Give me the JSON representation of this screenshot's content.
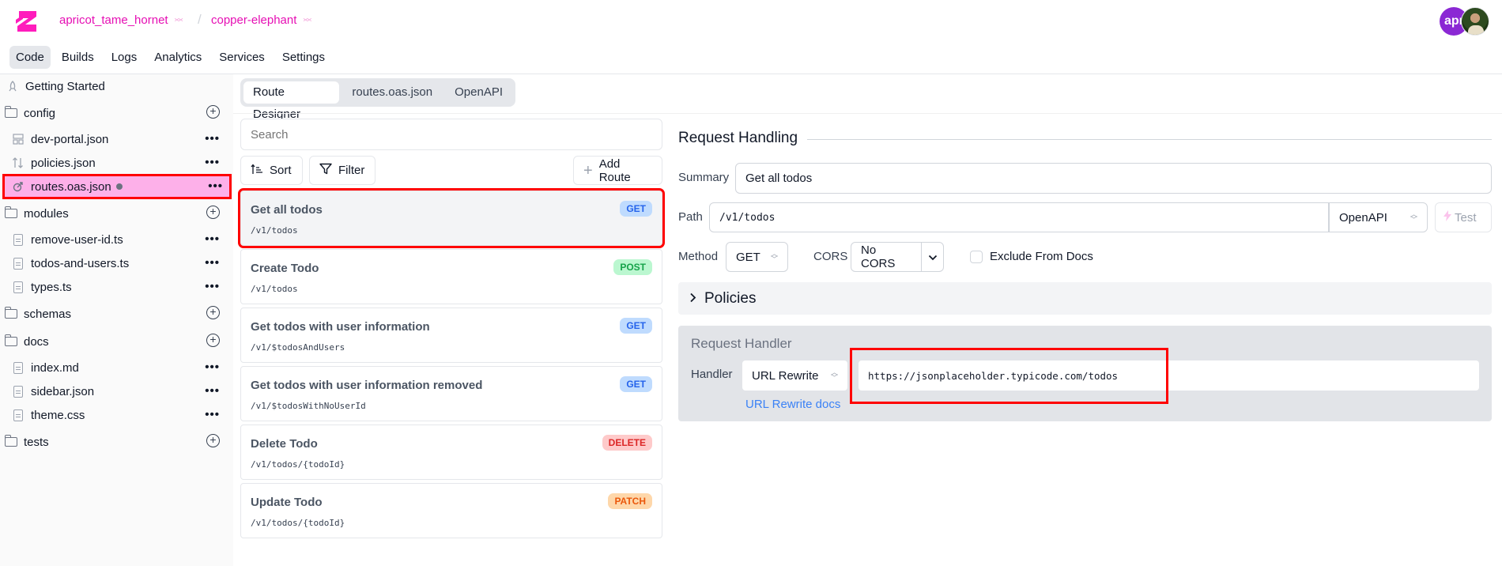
{
  "header": {
    "logo": "zuplo-logo-icon",
    "breadcrumb": {
      "account": "apricot_tame_hornet",
      "separator": "/",
      "project": "copper-elephant"
    },
    "nav_tabs": [
      {
        "label": "Code",
        "active": true
      },
      {
        "label": "Builds",
        "active": false
      },
      {
        "label": "Logs",
        "active": false
      },
      {
        "label": "Analytics",
        "active": false
      },
      {
        "label": "Services",
        "active": false
      },
      {
        "label": "Settings",
        "active": false
      }
    ],
    "avatars": [
      {
        "initials": "apr",
        "color": "#8b28d4"
      },
      {
        "type": "photo"
      }
    ]
  },
  "sidebar": {
    "getting_started": "Getting Started",
    "items": [
      {
        "type": "folder",
        "label": "config",
        "action": "add"
      },
      {
        "type": "file",
        "label": "dev-portal.json",
        "icon": "layout-icon",
        "action": "more"
      },
      {
        "type": "file",
        "label": "policies.json",
        "icon": "arrows-up-down-icon",
        "action": "more"
      },
      {
        "type": "file",
        "label": "routes.oas.json",
        "icon": "route-icon",
        "action": "more",
        "selected": true,
        "modified": true
      },
      {
        "type": "folder",
        "label": "modules",
        "action": "add"
      },
      {
        "type": "file",
        "label": "remove-user-id.ts",
        "icon": "file-icon",
        "action": "more"
      },
      {
        "type": "file",
        "label": "todos-and-users.ts",
        "icon": "file-icon",
        "action": "more"
      },
      {
        "type": "file",
        "label": "types.ts",
        "icon": "file-icon",
        "action": "more"
      },
      {
        "type": "folder",
        "label": "schemas",
        "action": "add"
      },
      {
        "type": "folder",
        "label": "docs",
        "action": "add"
      },
      {
        "type": "file",
        "label": "index.md",
        "icon": "file-icon",
        "action": "more"
      },
      {
        "type": "file",
        "label": "sidebar.json",
        "icon": "file-icon",
        "action": "more"
      },
      {
        "type": "file",
        "label": "theme.css",
        "icon": "file-icon",
        "action": "more"
      },
      {
        "type": "folder",
        "label": "tests",
        "action": "add"
      }
    ],
    "more_label": "•••",
    "add_label": "+"
  },
  "editor_tabs": [
    {
      "label": "Route Designer",
      "active": true
    },
    {
      "label": "routes.oas.json",
      "active": false
    },
    {
      "label": "OpenAPI",
      "active": false
    }
  ],
  "routes_panel": {
    "search_placeholder": "Search",
    "sort_label": "Sort",
    "filter_label": "Filter",
    "add_route_label": "Add Route",
    "routes": [
      {
        "name": "Get all todos",
        "path": "/v1/todos",
        "method": "GET",
        "selected": true
      },
      {
        "name": "Create Todo",
        "path": "/v1/todos",
        "method": "POST"
      },
      {
        "name": "Get todos with user information",
        "path": "/v1/$todosAndUsers",
        "method": "GET"
      },
      {
        "name": "Get todos with user information removed",
        "path": "/v1/$todosWithNoUserId",
        "method": "GET"
      },
      {
        "name": "Delete Todo",
        "path": "/v1/todos/{todoId}",
        "method": "DELETE"
      },
      {
        "name": "Update Todo",
        "path": "/v1/todos/{todoId}",
        "method": "PATCH"
      }
    ],
    "method_colors": {
      "GET": {
        "bg": "#bfdbfe",
        "fg": "#2563eb"
      },
      "POST": {
        "bg": "#bbf7d0",
        "fg": "#16a34a"
      },
      "DELETE": {
        "bg": "#fecaca",
        "fg": "#dc2626"
      },
      "PATCH": {
        "bg": "#fed7aa",
        "fg": "#ea580c"
      }
    }
  },
  "request_handling": {
    "title": "Request Handling",
    "summary_label": "Summary",
    "summary_value": "Get all todos",
    "path_label": "Path",
    "path_value": "/v1/todos",
    "path_format": "OpenAPI",
    "test_label": "Test",
    "method_label": "Method",
    "method_value": "GET",
    "cors_label": "CORS",
    "cors_value": "No CORS",
    "exclude_label": "Exclude From Docs",
    "exclude_checked": false,
    "policies_label": "Policies",
    "handler_section_title": "Request Handler",
    "handler_label": "Handler",
    "handler_type": "URL Rewrite",
    "handler_url": "https://jsonplaceholder.typicode.com/todos",
    "handler_docs_link": "URL Rewrite docs"
  },
  "colors": {
    "brand": "#e60fb4",
    "selection_highlight": "#fdb0e9",
    "annotation_red": "#ff0000",
    "link": "#3b82f6"
  }
}
